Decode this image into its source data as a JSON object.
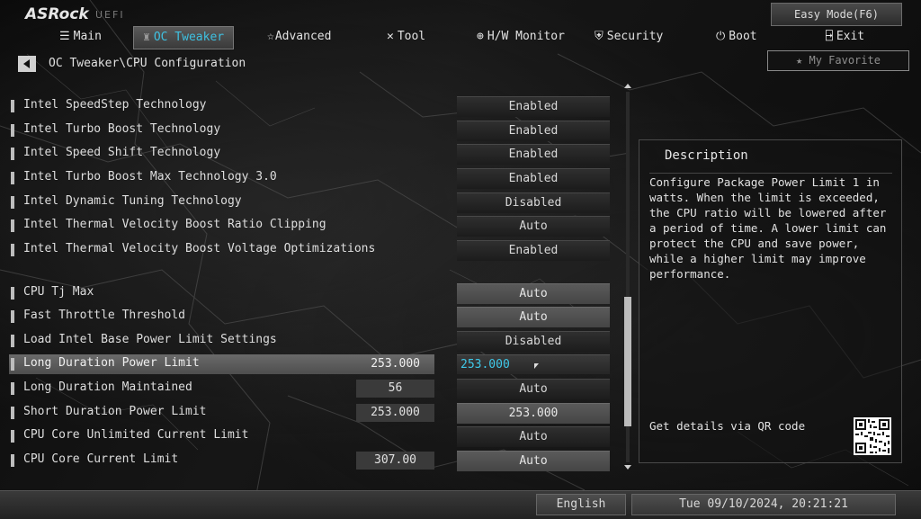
{
  "header": {
    "logo": "ASRock",
    "logo_sub": "UEFI",
    "easy_mode_label": "Easy Mode(F6)",
    "nav": [
      {
        "label": "Main",
        "icon": "list-icon"
      },
      {
        "label": "OC Tweaker",
        "icon": "rocket-icon",
        "active": true
      },
      {
        "label": "Advanced",
        "icon": "star-icon"
      },
      {
        "label": "Tool",
        "icon": "tools-icon"
      },
      {
        "label": "H/W Monitor",
        "icon": "globe-icon"
      },
      {
        "label": "Security",
        "icon": "shield-icon"
      },
      {
        "label": "Boot",
        "icon": "power-icon"
      },
      {
        "label": "Exit",
        "icon": "exit-icon"
      }
    ]
  },
  "breadcrumb": {
    "path": "OC Tweaker\\CPU Configuration",
    "favorite_label": "My Favorite"
  },
  "settings": [
    {
      "label": "Intel SpeedStep Technology",
      "value": "Enabled"
    },
    {
      "label": "Intel Turbo Boost Technology",
      "value": "Enabled"
    },
    {
      "label": "Intel Speed Shift Technology",
      "value": "Enabled"
    },
    {
      "label": "Intel Turbo Boost Max Technology 3.0",
      "value": "Enabled"
    },
    {
      "label": "Intel Dynamic Tuning Technology",
      "value": "Disabled"
    },
    {
      "label": "Intel Thermal Velocity Boost Ratio Clipping",
      "value": "Auto"
    },
    {
      "label": "Intel Thermal Velocity Boost Voltage Optimizations",
      "value": "Enabled"
    },
    {
      "label": "CPU Tj Max",
      "value": "Auto"
    },
    {
      "label": "Fast Throttle Threshold",
      "value": "Auto"
    },
    {
      "label": "Load Intel Base Power Limit Settings",
      "value": "Disabled"
    },
    {
      "label": "Long Duration Power Limit",
      "current": "253.000",
      "value": "253.000"
    },
    {
      "label": "Long Duration Maintained",
      "current": "56",
      "value": "Auto"
    },
    {
      "label": "Short Duration Power Limit",
      "current": "253.000",
      "value": "253.000"
    },
    {
      "label": "CPU Core Unlimited Current Limit",
      "value": "Auto"
    },
    {
      "label": "CPU Core Current Limit",
      "current": "307.00",
      "value": "Auto"
    }
  ],
  "description": {
    "title": "Description",
    "text": "Configure Package Power Limit 1 in watts. When the limit is exceeded, the CPU ratio will be lowered after a period of time. A lower limit can protect the CPU and save power, while a higher limit may improve performance.",
    "qr_label": "Get details via QR code"
  },
  "footer": {
    "language": "English",
    "datetime": "Tue 09/10/2024, 20:21:21"
  },
  "colors": {
    "accent": "#3fc0e0"
  }
}
